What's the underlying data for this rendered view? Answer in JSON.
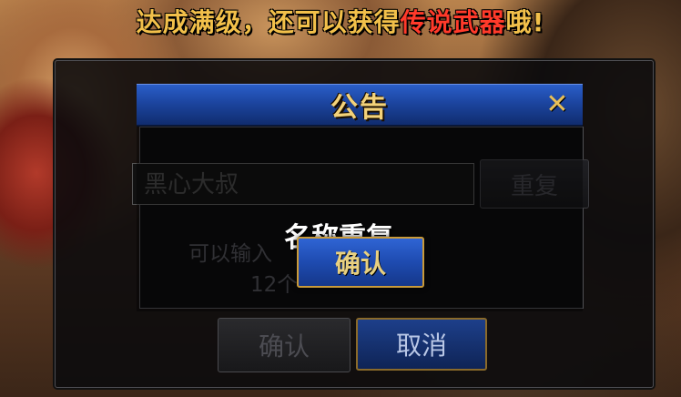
{
  "banner": {
    "part1": "达成满级，还可以获得",
    "part2": "传说武器",
    "part3": "哦!"
  },
  "create_dialog": {
    "name_input_value": "黑心大叔",
    "check_dup_label": "重复",
    "hint_line1": "可以输入",
    "hint_line2": "12个",
    "confirm_label": "确认",
    "cancel_label": "取消"
  },
  "notice": {
    "title": "公告",
    "close_glyph": "✕",
    "message": "名称重复。",
    "confirm_label": "确认"
  },
  "colors": {
    "title_gold": "#f3d27a",
    "button_blue": "#1e4bb0",
    "banner_red": "#ff3a2a",
    "banner_gold": "#f2c04a"
  }
}
